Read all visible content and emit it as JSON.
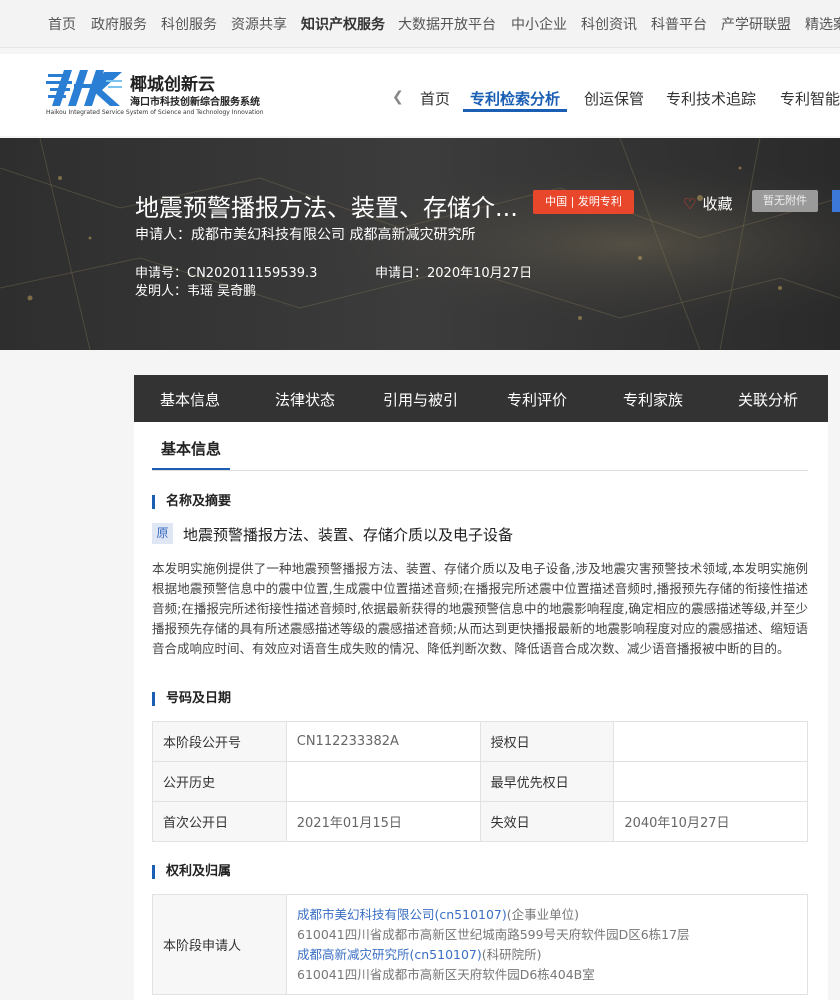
{
  "topnav": {
    "items": [
      "首页",
      "政府服务",
      "科创服务",
      "资源共享",
      "知识产权服务",
      "大数据开放平台",
      "中小企业",
      "科创资讯",
      "科普平台",
      "产学研联盟",
      "精选案"
    ],
    "active_index": 4
  },
  "header": {
    "logo_title": "椰城创新云",
    "logo_subtitle": "海口市科技创新综合服务系统",
    "logo_en": "Haikou Integrated Service System of Science and Technology Innovation",
    "nav": [
      "首页",
      "专利检索分析",
      "创运保管",
      "专利技术追踪",
      "专利智能"
    ],
    "nav_active_index": 1
  },
  "banner": {
    "title": "地震预警播报方法、装置、存储介...",
    "tag": "中国 | 发明专利",
    "favorite": "收藏",
    "no_attachment": "暂无附件",
    "applicant": "申请人：成都市美幻科技有限公司 成都高新减灾研究所",
    "app_no": "申请号：CN202011159539.3",
    "app_date": "申请日：2020年10月27日",
    "inventor": "发明人：韦瑶 吴奇鹏"
  },
  "tabs": [
    "基本信息",
    "法律状态",
    "引用与被引",
    "专利评价",
    "专利家族",
    "关联分析"
  ],
  "content": {
    "subtab": "基本信息",
    "section_name": "名称及摘要",
    "yuan_badge": "原",
    "patent_name": "地震预警播报方法、装置、存储介质以及电子设备",
    "abstract": "本发明实施例提供了一种地震预警播报方法、装置、存储介质以及电子设备,涉及地震灾害预警技术领域,本发明实施例根据地震预警信息中的震中位置,生成震中位置描述音频;在播报完所述震中位置描述音频时,播报预先存储的衔接性描述音频;在播报完所述衔接性描述音频时,依据最新获得的地震预警信息中的地震影响程度,确定相应的震感描述等级,并至少播报预先存储的具有所述震感描述等级的震感描述音频;从而达到更快播报最新的地震影响程度对应的震感描述、缩短语音合成响应时间、有效应对语音生成失败的情况、降低判断次数、降低语音合成次数、减少语音播报被中断的目的。",
    "section_numbers": "号码及日期",
    "numbers_table": [
      [
        "本阶段公开号",
        "CN112233382A",
        "授权日",
        ""
      ],
      [
        "公开历史",
        "",
        "最早优先权日",
        ""
      ],
      [
        "首次公开日",
        "2021年01月15日",
        "失效日",
        "2040年10月27日"
      ]
    ],
    "section_rights": "权利及归属",
    "owner_label": "本阶段申请人",
    "owners": [
      {
        "name": "成都市美幻科技有限公司(cn510107)",
        "type": "(企事业单位)",
        "address": "610041四川省成都市高新区世纪城南路599号天府软件园D区6栋17层"
      },
      {
        "name": "成都高新减灾研究所(cn510107)",
        "type": "(科研院所)",
        "address": "610041四川省成都市高新区天府软件园D6栋404B室"
      }
    ]
  }
}
